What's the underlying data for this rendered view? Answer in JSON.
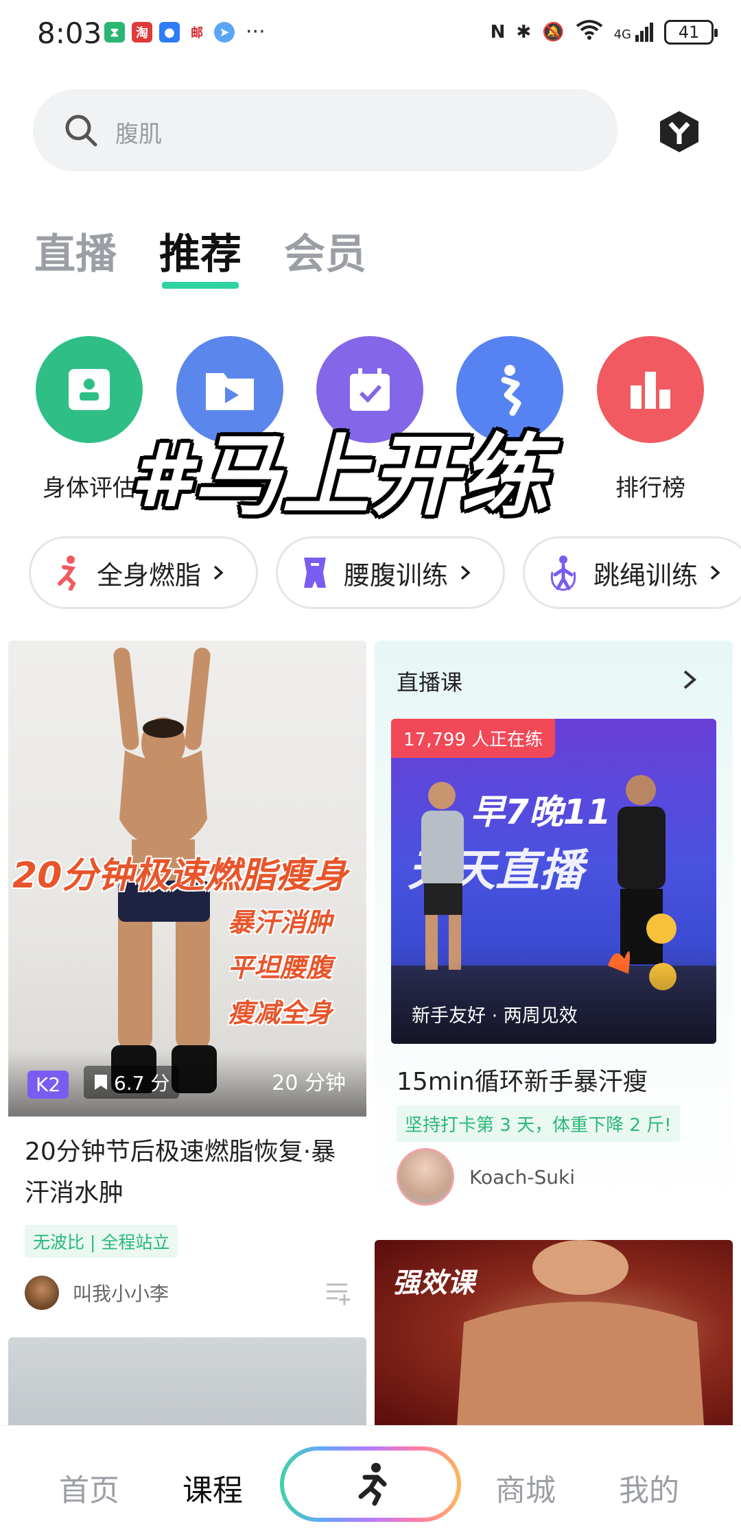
{
  "status_bar": {
    "time": "8:03",
    "network": "4G",
    "battery": "41"
  },
  "search": {
    "placeholder": "腹肌"
  },
  "tabs": [
    {
      "label": "直播",
      "active": false
    },
    {
      "label": "推荐",
      "active": true
    },
    {
      "label": "会员",
      "active": false
    }
  ],
  "quick_actions": [
    {
      "label": "身体评估",
      "color": "#2fbf86",
      "icon": "body-assessment-icon"
    },
    {
      "label": "",
      "color": "#5b86ec",
      "icon": "folder-play-icon"
    },
    {
      "label": "",
      "color": "#8466e8",
      "icon": "calendar-check-icon"
    },
    {
      "label": "",
      "color": "#5782f2",
      "icon": "running-figure-icon"
    },
    {
      "label": "排行榜",
      "color": "#f15a60",
      "icon": "leaderboard-icon"
    }
  ],
  "overlay_caption": "#马上开练",
  "categories": [
    {
      "label": "全身燃脂",
      "icon": "running-person-icon",
      "color": "#f15a60"
    },
    {
      "label": "腰腹训练",
      "icon": "waist-icon",
      "color": "#7b5cf0"
    },
    {
      "label": "跳绳训练",
      "icon": "jump-rope-icon",
      "color": "#7b5cf0"
    }
  ],
  "feed_left": {
    "headline": "20分钟极速燃脂瘦身",
    "sublines": [
      "暴汗消肿",
      "平坦腰腹",
      "瘦减全身"
    ],
    "level": "K2",
    "rating": "6.7 分",
    "duration": "20 分钟",
    "title": "20分钟节后极速燃脂恢复·暴汗消水肿",
    "tag": "无波比 | 全程站立",
    "author": "叫我小小李"
  },
  "feed_right": {
    "section_title": "直播课",
    "live_count": "17,799 人正在练",
    "banner_line1": "早7晚11",
    "banner_line2": "天天直播",
    "caption": "新手友好 · 两周见效",
    "title": "15min循环新手暴汗瘦",
    "tag": "坚持打卡第 3 天，体重下降 2 斤!",
    "coach": "Koach-Suki"
  },
  "feed_peek_right": {
    "badge": "强效课"
  },
  "bottom_nav": {
    "home": "首页",
    "courses": "课程",
    "mall": "商城",
    "mine": "我的"
  }
}
